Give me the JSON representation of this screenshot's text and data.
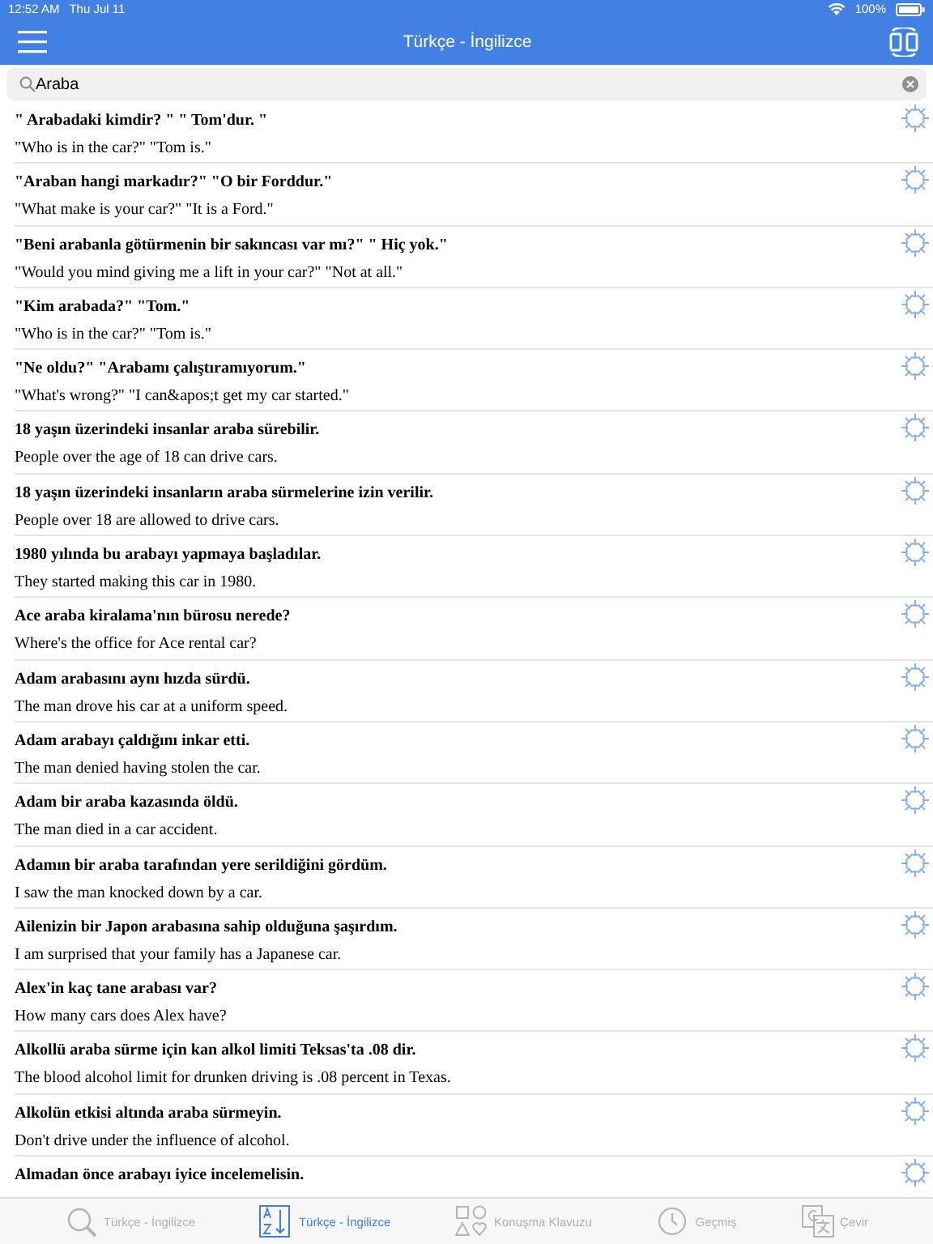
{
  "status_bar": {
    "time": "12:52 AM",
    "date": "Thu Jul 11",
    "battery": "100%"
  },
  "nav_bar": {
    "title": "Türkçe - İngilizce"
  },
  "search": {
    "value": "Araba"
  },
  "results": [
    {
      "turkish": "\" Arabadaki kimdir? \" \" Tom'dur. \"",
      "english": "\"Who is in the car?\" \"Tom is.\""
    },
    {
      "turkish": "\"Araban hangi markadır?\" \"O bir Forddur.\"",
      "english": "\"What make is your car?\" \"It is a Ford.\""
    },
    {
      "turkish": "\"Beni arabanla götürmenin bir sakıncası var mı?\" \" Hiç yok.\"",
      "english": "\"Would you mind giving me a lift in your car?\" \"Not at all.\""
    },
    {
      "turkish": "\"Kim arabada?\" \"Tom.\"",
      "english": "\"Who is in the car?\" \"Tom is.\""
    },
    {
      "turkish": "\"Ne oldu?\" \"Arabamı çalıştıramıyorum.\"",
      "english": "\"What's wrong?\" \"I can&apos;t get my car started.\""
    },
    {
      "turkish": "18 yaşın üzerindeki insanlar araba sürebilir.",
      "english": "People over the age of 18 can drive cars."
    },
    {
      "turkish": "18 yaşın üzerindeki insanların araba sürmelerine izin verilir.",
      "english": "People over 18 are allowed to drive cars."
    },
    {
      "turkish": "1980 yılında bu arabayı yapmaya başladılar.",
      "english": "They started making this car in 1980."
    },
    {
      "turkish": "Ace araba kiralama'nın bürosu nerede?",
      "english": "Where's the office for Ace rental car?"
    },
    {
      "turkish": "Adam arabasını aynı hızda sürdü.",
      "english": "The man drove his car at a uniform speed."
    },
    {
      "turkish": "Adam arabayı çaldığını inkar etti.",
      "english": "The man denied having stolen the car."
    },
    {
      "turkish": "Adam bir araba kazasında öldü.",
      "english": "The man died in a car accident."
    },
    {
      "turkish": "Adamın bir araba tarafından yere serildiğini gördüm.",
      "english": "I saw the man knocked down by a car."
    },
    {
      "turkish": "Ailenizin bir Japon arabasına sahip olduğuna şaşırdım.",
      "english": "I am surprised that your family has a Japanese car."
    },
    {
      "turkish": "Alex'in kaç tane arabası var?",
      "english": "How many cars does Alex have?"
    },
    {
      "turkish": "Alkollü araba sürme için kan alkol limiti Teksas'ta .08 dir.",
      "english": "The blood alcohol limit for drunken driving is .08 percent in Texas."
    },
    {
      "turkish": "Alkolün etkisi altında araba sürmeyin.",
      "english": "Don't drive under the influence of alcohol."
    },
    {
      "turkish": "Almadan önce arabayı iyice incelemelisin."
    }
  ],
  "tab_bar": [
    {
      "kind": "search",
      "label": "Türkçe - İngilizce",
      "selected": false
    },
    {
      "kind": "az",
      "label": "Türkçe - İngilizce",
      "selected": true
    },
    {
      "kind": "shapes",
      "label": "Konuşma Klavuzu",
      "selected": false
    },
    {
      "kind": "history",
      "label": "Geçmiş",
      "selected": false
    },
    {
      "kind": "translate",
      "label": "Çevir",
      "selected": false
    }
  ]
}
